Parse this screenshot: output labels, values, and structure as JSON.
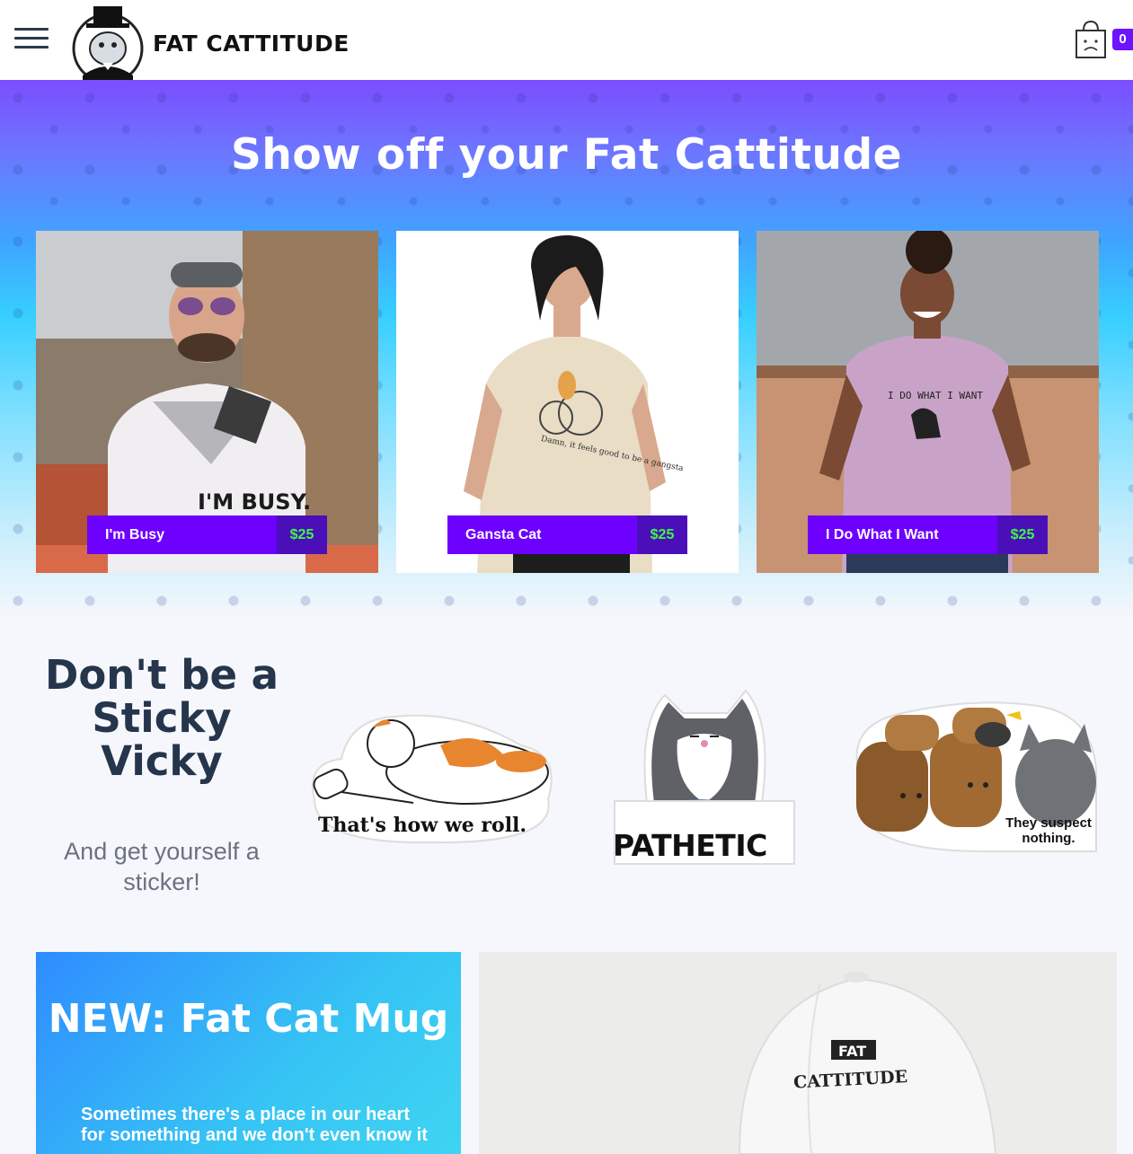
{
  "header": {
    "brand": "FAT CATTITUDE",
    "cart_count": "0"
  },
  "hero": {
    "title": "Show off your Fat Cattitude",
    "products": [
      {
        "name": "I'm Busy",
        "price": "$25",
        "shirt_text": "I'M BUSY."
      },
      {
        "name": "Gansta Cat",
        "price": "$25",
        "shirt_text": "Damn, it feels good to be a gangsta"
      },
      {
        "name": "I Do What I Want",
        "price": "$25",
        "shirt_text": "I DO WHAT I WANT"
      }
    ]
  },
  "stickers": {
    "title": "Don't be a Sticky Vicky",
    "subtitle": "And get yourself a sticker!",
    "items": [
      {
        "caption": "That's how we roll."
      },
      {
        "caption": "PATHETIC"
      },
      {
        "caption": "They suspect nothing."
      }
    ]
  },
  "mug": {
    "title": "NEW: Fat Cat Mug",
    "text": "Sometimes there's a place in our heart for something and we don't even know it"
  },
  "cap": {
    "logo_top": "FAT",
    "logo_bottom": "CATTITUDE"
  },
  "colors": {
    "accent": "#6d00ff",
    "price_green": "#39ff3d",
    "heading": "#25354b"
  }
}
